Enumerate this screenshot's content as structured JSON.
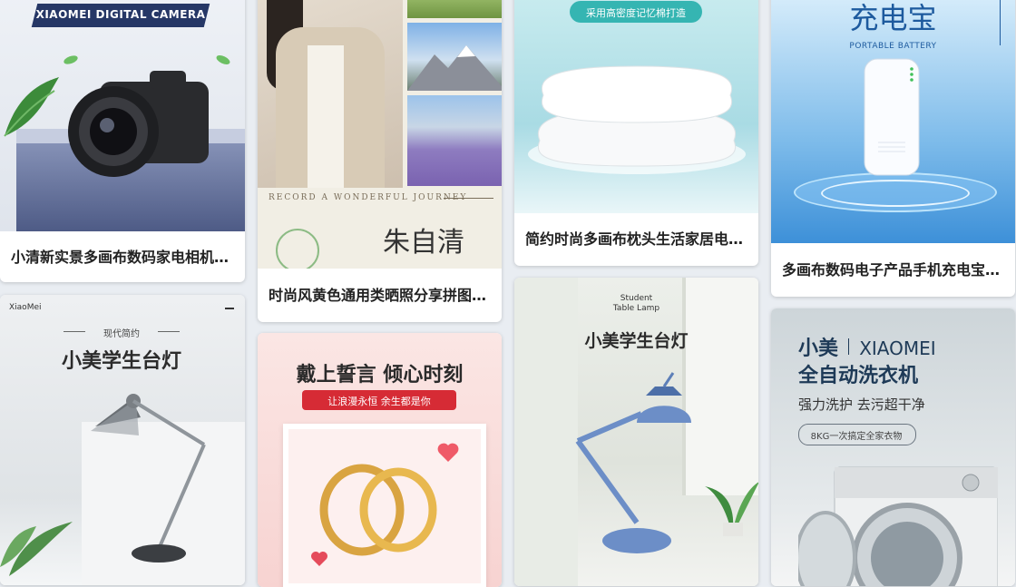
{
  "cards": [
    {
      "title": "小清新实景多画布数码家电相机电商主图",
      "banner": "XIAOMEI DIGITAL CAMERA",
      "icon": "camera-icon"
    },
    {
      "title": "时尚风黄色通用类晒照分享拼图海报",
      "caption": "RECORD A WONDERFUL JOURNEY",
      "icon": "collage-icon"
    },
    {
      "title": "简约时尚多画布枕头生活家居电商主图",
      "tag": "采用高密度记忆棉打造",
      "icon": "pillow-icon"
    },
    {
      "title": "多画布数码电子产品手机充电宝电商主图",
      "heading": "充电宝",
      "sub": "PORTABLE BATTERY",
      "icon": "power-bank-icon"
    },
    {
      "brand": "XiaoMei",
      "small_heading": "现代简约",
      "heading": "小美学生台灯",
      "icon": "desk-lamp-icon"
    },
    {
      "heading": "戴上誓言 倾心时刻",
      "ribbon": "让浪漫永恒 余生都是你",
      "icon": "rings-icon"
    },
    {
      "small1": "Student",
      "small2": "Table Lamp",
      "heading": "小美学生台灯",
      "icon": "desk-lamp-icon"
    },
    {
      "heading1a": "小美",
      "heading1b": "XIAOMEI",
      "heading2": "全自动洗衣机",
      "sub": "强力洗护 去污超干净",
      "pill": "8KG一次搞定全家衣物",
      "icon": "washing-machine-icon"
    }
  ]
}
